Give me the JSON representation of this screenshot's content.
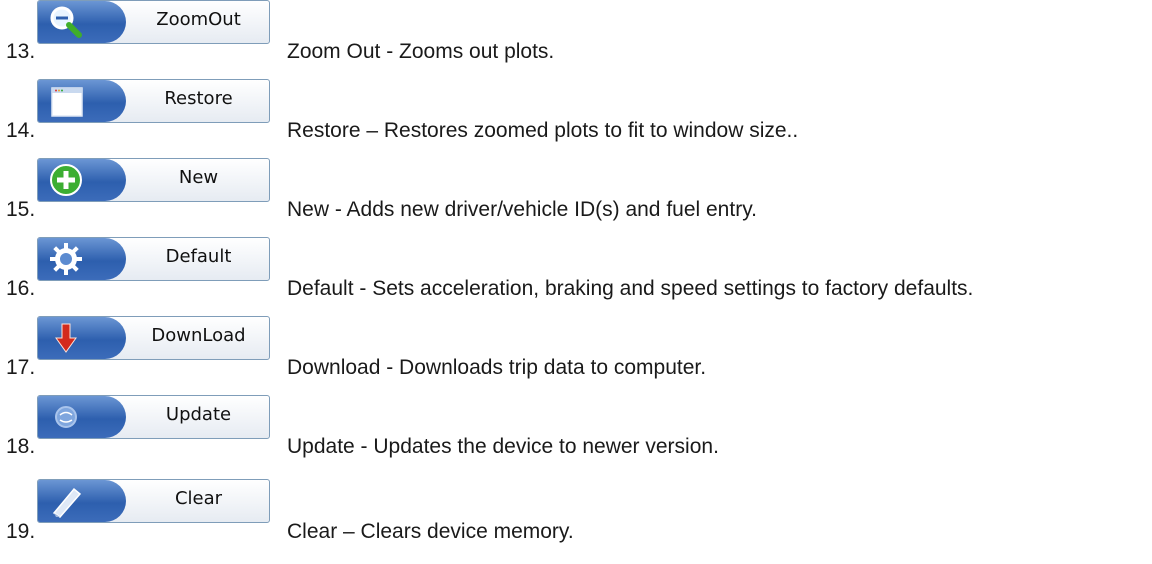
{
  "items": [
    {
      "num": "13.",
      "button_label": "ZoomOut",
      "icon": "zoom-out-icon",
      "description": "Zoom Out - Zooms out plots."
    },
    {
      "num": "14.",
      "button_label": "Restore",
      "icon": "window-restore-icon",
      "description": "Restore – Restores zoomed plots to fit to window size.."
    },
    {
      "num": "15.",
      "button_label": "New",
      "icon": "plus-circle-icon",
      "description": "New - Adds new driver/vehicle ID(s) and fuel entry."
    },
    {
      "num": "16.",
      "button_label": "Default",
      "icon": "gear-icon",
      "description": "Default - Sets acceleration, braking and speed settings to factory defaults."
    },
    {
      "num": "17.",
      "button_label": "DownLoad",
      "icon": "download-arrow-icon",
      "description": "Download - Downloads trip data to computer."
    },
    {
      "num": "18.",
      "button_label": "Update",
      "icon": "update-globe-icon",
      "description": "Update - Updates the device to newer version."
    },
    {
      "num": "19.",
      "button_label": "Clear",
      "icon": "eraser-icon",
      "description": "Clear – Clears device memory."
    }
  ],
  "colors": {
    "pill": "#2d5fae",
    "button_border": "#7f9db9"
  }
}
